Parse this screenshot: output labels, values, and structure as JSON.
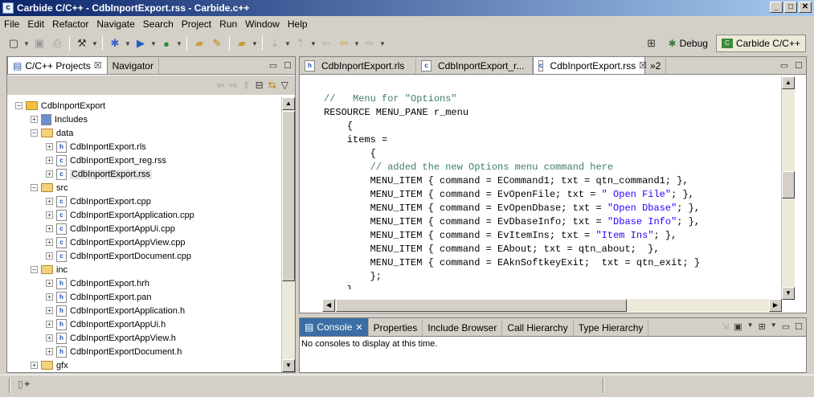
{
  "window": {
    "title": "Carbide C/C++ - CdbInportExport.rss - Carbide.c++",
    "app_icon": "carbide-icon",
    "min": "_",
    "max": "□",
    "close": "✕"
  },
  "menu": [
    "File",
    "Edit",
    "Refactor",
    "Navigate",
    "Search",
    "Project",
    "Run",
    "Window",
    "Help"
  ],
  "perspectives": {
    "debug": "Debug",
    "carbide": "Carbide C/C++"
  },
  "left_pane": {
    "tabs": [
      {
        "label": "C/C++ Projects"
      },
      {
        "label": "Navigator"
      }
    ],
    "tree": [
      {
        "label": "CdbInportExport",
        "icon": "project",
        "exp": "−"
      },
      {
        "label": "Includes",
        "icon": "includes",
        "exp": "+"
      },
      {
        "label": "data",
        "icon": "folder",
        "exp": "−"
      },
      {
        "label": "CdbInportExport.rls",
        "icon": "h",
        "exp": "+"
      },
      {
        "label": "CdbInportExport_reg.rss",
        "icon": "c",
        "exp": "+"
      },
      {
        "label": "CdbInportExport.rss",
        "icon": "c",
        "exp": "+",
        "selected": true
      },
      {
        "label": "src",
        "icon": "folder",
        "exp": "−"
      },
      {
        "label": "CdbInportExport.cpp",
        "icon": "c",
        "exp": "+"
      },
      {
        "label": "CdbInportExportApplication.cpp",
        "icon": "c",
        "exp": "+"
      },
      {
        "label": "CdbInportExportAppUi.cpp",
        "icon": "c",
        "exp": "+"
      },
      {
        "label": "CdbInportExportAppView.cpp",
        "icon": "c",
        "exp": "+"
      },
      {
        "label": "CdbInportExportDocument.cpp",
        "icon": "c",
        "exp": "+"
      },
      {
        "label": "inc",
        "icon": "folder",
        "exp": "−"
      },
      {
        "label": "CdbInportExport.hrh",
        "icon": "h",
        "exp": "+"
      },
      {
        "label": "CdbInportExport.pan",
        "icon": "h",
        "exp": "+"
      },
      {
        "label": "CdbInportExportApplication.h",
        "icon": "h",
        "exp": "+"
      },
      {
        "label": "CdbInportExportAppUi.h",
        "icon": "h",
        "exp": "+"
      },
      {
        "label": "CdbInportExportAppView.h",
        "icon": "h",
        "exp": "+"
      },
      {
        "label": "CdbInportExportDocument.h",
        "icon": "h",
        "exp": "+"
      },
      {
        "label": "gfx",
        "icon": "folder",
        "exp": "+"
      }
    ]
  },
  "editor": {
    "tabs": [
      {
        "label": "CdbInportExport.rls",
        "icon": "h"
      },
      {
        "label": "CdbInportExport_r...",
        "icon": "c"
      },
      {
        "label": "CdbInportExport.rss",
        "icon": "c",
        "active": true
      }
    ],
    "overflow": "»2",
    "lines": [
      [
        {
          "t": "//   Menu for \"Options\"",
          "c": "cmt"
        }
      ],
      [
        {
          "t": "RESOURCE MENU_PANE r_menu",
          "c": ""
        }
      ],
      [
        {
          "t": "    {",
          "c": ""
        }
      ],
      [
        {
          "t": "    items =",
          "c": ""
        }
      ],
      [
        {
          "t": "        {",
          "c": ""
        }
      ],
      [
        {
          "t": "        // added the new Options menu command here",
          "c": "cmt"
        }
      ],
      [
        {
          "t": "        MENU_ITEM { command = ECommand1; txt = qtn_command1; },",
          "c": ""
        }
      ],
      [
        {
          "t": "        MENU_ITEM { command = EvOpenFile; txt = ",
          "c": ""
        },
        {
          "t": "\" Open File\"",
          "c": "str"
        },
        {
          "t": "; },",
          "c": ""
        }
      ],
      [
        {
          "t": "        MENU_ITEM { command = EvOpenDbase; txt = ",
          "c": ""
        },
        {
          "t": "\"Open Dbase\"",
          "c": "str"
        },
        {
          "t": "; },",
          "c": ""
        }
      ],
      [
        {
          "t": "        MENU_ITEM { command = EvDbaseInfo; txt = ",
          "c": ""
        },
        {
          "t": "\"Dbase Info\"",
          "c": "str"
        },
        {
          "t": "; },",
          "c": ""
        }
      ],
      [
        {
          "t": "        MENU_ITEM { command = EvItemIns; txt = ",
          "c": ""
        },
        {
          "t": "\"Item Ins\"",
          "c": "str"
        },
        {
          "t": "; },",
          "c": ""
        }
      ],
      [
        {
          "t": "        MENU_ITEM { command = EAbout; txt = qtn_about;  },",
          "c": ""
        }
      ],
      [
        {
          "t": "        MENU_ITEM { command = EAknSoftkeyExit;  txt = qtn_exit; }",
          "c": ""
        }
      ],
      [
        {
          "t": "        };",
          "c": ""
        }
      ],
      [
        {
          "t": "    }",
          "c": ""
        }
      ]
    ]
  },
  "console": {
    "tabs": [
      {
        "label": "Console",
        "active": true
      },
      {
        "label": "Properties"
      },
      {
        "label": "Include Browser"
      },
      {
        "label": "Call Hierarchy"
      },
      {
        "label": "Type Hierarchy"
      }
    ],
    "message": "No consoles to display at this time."
  },
  "colors": {
    "comment": "#3f7f5f",
    "string": "#2a00ff",
    "title_start": "#0a246a",
    "title_end": "#a6caf0"
  }
}
